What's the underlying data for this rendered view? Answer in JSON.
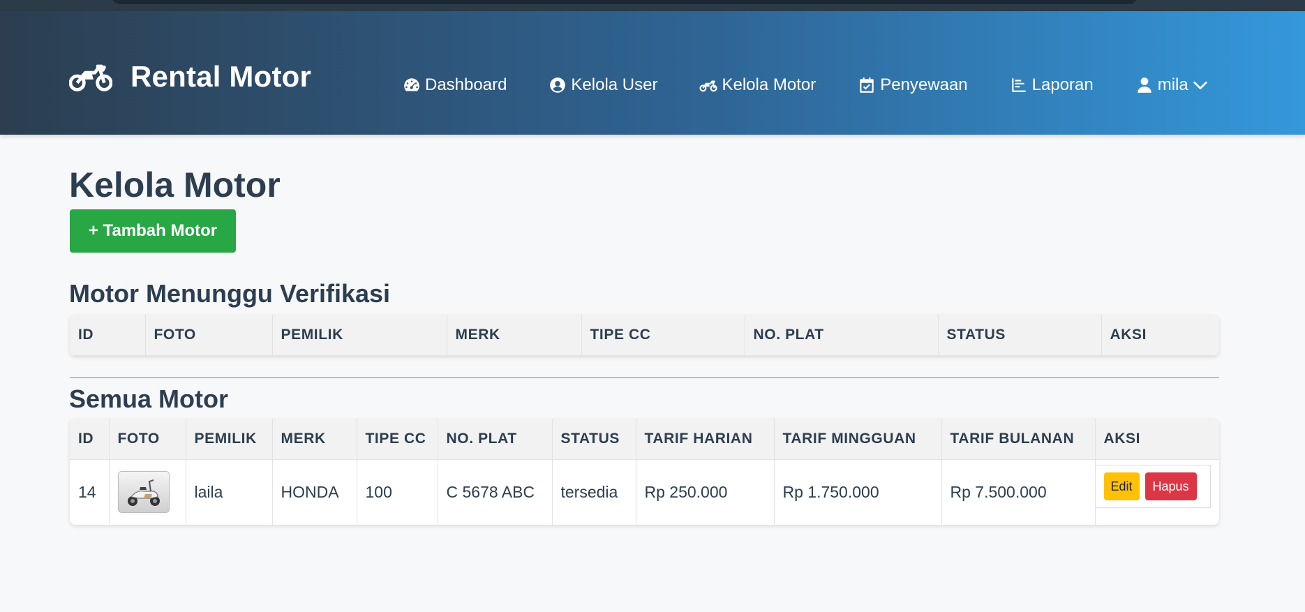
{
  "brand": {
    "title": "Rental Motor",
    "icon": "motorcycle-icon"
  },
  "nav": [
    {
      "label": "Dashboard",
      "icon": "speedometer-icon"
    },
    {
      "label": "Kelola User",
      "icon": "user-circle-icon"
    },
    {
      "label": "Kelola Motor",
      "icon": "motorcycle-icon"
    },
    {
      "label": "Penyewaan",
      "icon": "calendar-check-icon"
    },
    {
      "label": "Laporan",
      "icon": "chart-icon"
    }
  ],
  "user": {
    "name": "mila",
    "icon": "user-icon",
    "dropdown_icon": "chevron-down-icon"
  },
  "page": {
    "title": "Kelola Motor",
    "add_button": "+ Tambah Motor"
  },
  "pending": {
    "title": "Motor Menunggu Verifikasi",
    "columns": [
      "ID",
      "FOTO",
      "PEMILIK",
      "MERK",
      "TIPE CC",
      "NO. PLAT",
      "STATUS",
      "AKSI"
    ]
  },
  "all": {
    "title": "Semua Motor",
    "columns": [
      "ID",
      "FOTO",
      "PEMILIK",
      "MERK",
      "TIPE CC",
      "NO. PLAT",
      "STATUS",
      "TARIF HARIAN",
      "TARIF MINGGUAN",
      "TARIF BULANAN",
      "AKSI"
    ],
    "rows": [
      {
        "id": "14",
        "photo": "scooter-photo",
        "owner": "laila",
        "brand": "HONDA",
        "cc": "100",
        "plate": "C 5678 ABC",
        "status": "tersedia",
        "daily": "Rp 250.000",
        "weekly": "Rp 1.750.000",
        "monthly": "Rp 7.500.000",
        "edit_label": "Edit",
        "delete_label": "Hapus"
      }
    ]
  },
  "colors": {
    "header_start": "#2c3e50",
    "header_end": "#3498db",
    "add_button": "#28a745",
    "edit_button": "#ffc107",
    "delete_button": "#dc3545"
  }
}
